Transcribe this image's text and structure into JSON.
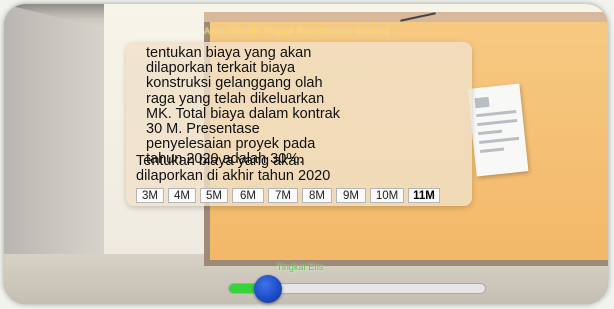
{
  "header": {
    "title": "Anda Memilih Tingkat Penyelesaian Gedung ..."
  },
  "question": {
    "text": "tentukan biaya yang akan\ndilaporkan terkait biaya\nkonstruksi gelanggang olah\nraga yang telah dikeluarkan\nMK. Total biaya dalam kontrak\n30 M. Presentase\npenyelesaian proyek pada\ntahun 2020 adalah 30%.",
    "prompt": "Tentukan biaya yang akan\ndilaporkan di akhir tahun 2020"
  },
  "options": [
    "3M",
    "4M",
    "5M",
    "6M",
    "7M",
    "8M",
    "9M",
    "10M",
    "11M"
  ],
  "slider": {
    "label": "Tingkat Etis",
    "value": 0.15,
    "fill_color": "#34d43a",
    "knob_color": "#1c49c4"
  },
  "colors": {
    "header_text": "#f2d250",
    "slider_label": "#56c24c",
    "board": "#f3b869"
  }
}
